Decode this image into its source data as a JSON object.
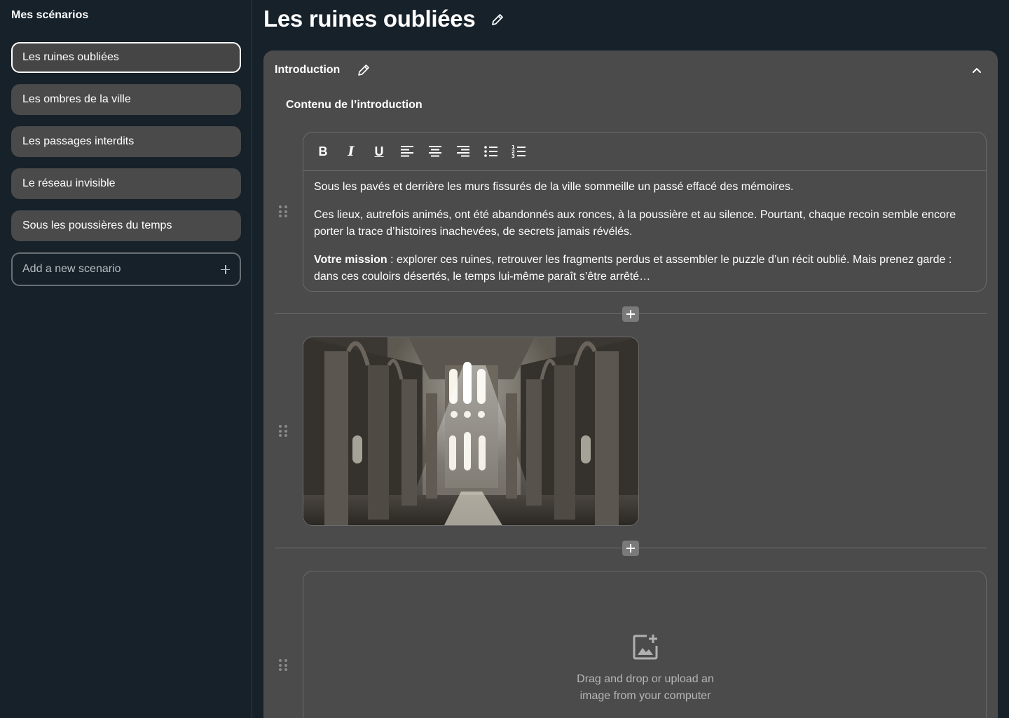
{
  "sidebar": {
    "title": "Mes scénarios",
    "scenarios": [
      {
        "label": "Les ruines oubliées",
        "active": true
      },
      {
        "label": "Les ombres de la ville"
      },
      {
        "label": "Les passages interdits"
      },
      {
        "label": "Le réseau invisible"
      },
      {
        "label": "Sous les poussières du temps"
      }
    ],
    "add_label": "Add a new scenario"
  },
  "main": {
    "title": "Les ruines oubliées",
    "section": {
      "label": "Introduction",
      "content_label": "Contenu de l’introduction",
      "editor": {
        "toolbar": {
          "bold": "B",
          "italic": "I",
          "underline": "U"
        },
        "paragraphs": [
          "Sous les pavés et derrière les murs fissurés de la ville sommeille un passé effacé des mémoires.",
          "Ces lieux, autrefois animés, ont été abandonnés aux ronces, à la poussière et au silence. Pourtant, chaque recoin semble encore porter la trace d’histoires inachevées, de secrets jamais révélés."
        ],
        "mission_strong": "Votre mission",
        "mission_text": " : explorer ces ruines, retrouver les fragments perdus et assembler le puzzle d’un récit oublié. Mais prenez garde : dans ces couloirs désertés, le temps lui-même paraît s’être arrêté…"
      },
      "upload": {
        "line1": "Drag and drop or upload an",
        "line2": "image from your computer"
      }
    }
  },
  "icons": {
    "edit": "pencil-icon",
    "collapse": "chevron-up-icon",
    "drag": "drag-handle-icon",
    "add": "plus-icon",
    "upload": "add-image-icon"
  },
  "colors": {
    "background": "#16212a",
    "panel": "#4b4b4b",
    "item": "#4a4a4a"
  }
}
